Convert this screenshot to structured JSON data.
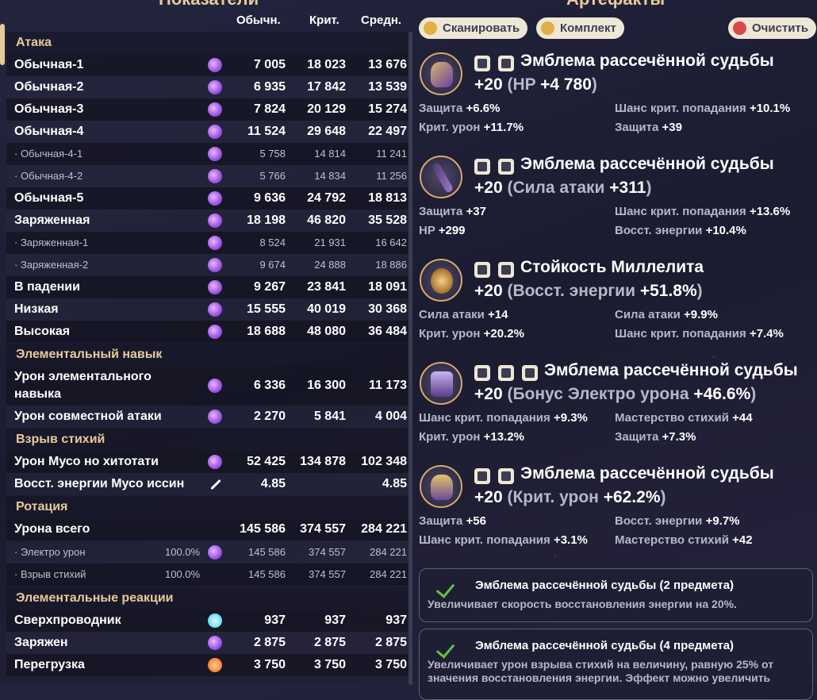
{
  "stats_title": "Показатели",
  "columns": {
    "normal": "Обычн.",
    "crit": "Крит.",
    "avg": "Средн."
  },
  "sections": [
    {
      "title": "Атака"
    },
    {
      "title": "Элементальный навык"
    },
    {
      "title": "Взрыв стихий"
    },
    {
      "title": "Ротация"
    },
    {
      "title": "Элементальные реакции"
    }
  ],
  "rows": [
    {
      "name": "Обычная-1",
      "icon": "electro-icon",
      "normal": "7 005",
      "crit": "18 023",
      "avg": "13 676"
    },
    {
      "name": "Обычная-2",
      "icon": "electro-icon",
      "normal": "6 935",
      "crit": "17 842",
      "avg": "13 539"
    },
    {
      "name": "Обычная-3",
      "icon": "electro-icon",
      "normal": "7 824",
      "crit": "20 129",
      "avg": "15 274"
    },
    {
      "name": "Обычная-4",
      "icon": "electro-icon",
      "normal": "11 524",
      "crit": "29 648",
      "avg": "22 497"
    },
    {
      "name": "· Обычная-4-1",
      "icon": "electro-icon",
      "normal": "5 758",
      "crit": "14 814",
      "avg": "11 241"
    },
    {
      "name": "· Обычная-4-2",
      "icon": "electro-icon",
      "normal": "5 766",
      "crit": "14 834",
      "avg": "11 256"
    },
    {
      "name": "Обычная-5",
      "icon": "electro-icon",
      "normal": "9 636",
      "crit": "24 792",
      "avg": "18 813"
    },
    {
      "name": "Заряженная",
      "icon": "electro-icon",
      "normal": "18 198",
      "crit": "46 820",
      "avg": "35 528"
    },
    {
      "name": "· Заряженная-1",
      "icon": "electro-icon",
      "normal": "8 524",
      "crit": "21 931",
      "avg": "16 642"
    },
    {
      "name": "· Заряженная-2",
      "icon": "electro-icon",
      "normal": "9 674",
      "crit": "24 888",
      "avg": "18 886"
    },
    {
      "name": "В падении",
      "icon": "electro-icon",
      "normal": "9 267",
      "crit": "23 841",
      "avg": "18 091"
    },
    {
      "name": "Низкая",
      "icon": "electro-icon",
      "normal": "15 555",
      "crit": "40 019",
      "avg": "30 368"
    },
    {
      "name": "Высокая",
      "icon": "electro-icon",
      "normal": "18 688",
      "crit": "48 080",
      "avg": "36 484"
    },
    {
      "name": "Урон элементального навыка",
      "icon": "electro-icon",
      "normal": "6 336",
      "crit": "16 300",
      "avg": "11 173"
    },
    {
      "name": "Урон совместной атаки",
      "icon": "electro-icon",
      "normal": "2 270",
      "crit": "5 841",
      "avg": "4 004"
    },
    {
      "name": "Урон Мусо но хитотати",
      "icon": "electro-icon",
      "normal": "52 425",
      "crit": "134 878",
      "avg": "102 348"
    },
    {
      "name": "Восст. энергии Мусо иссин",
      "icon": "sword-icon",
      "normal": "4.85",
      "crit": "",
      "avg": "4.85"
    },
    {
      "name": "Урона всего",
      "icon": "",
      "normal": "145 586",
      "crit": "374 557",
      "avg": "284 221"
    },
    {
      "name": "· Электро урон",
      "pct": "100.0%",
      "icon": "electro-icon",
      "normal": "145 586",
      "crit": "374 557",
      "avg": "284 221"
    },
    {
      "name": "· Взрыв стихий",
      "pct": "100.0%",
      "icon": "",
      "normal": "145 586",
      "crit": "374 557",
      "avg": "284 221"
    },
    {
      "name": "Сверхпроводник",
      "icon": "cryo-icon",
      "normal": "937",
      "crit": "937",
      "avg": "937"
    },
    {
      "name": "Заряжен",
      "icon": "electro-icon",
      "normal": "2 875",
      "crit": "2 875",
      "avg": "2 875"
    },
    {
      "name": "Перегрузка",
      "icon": "pyro-icon",
      "normal": "3 750",
      "crit": "3 750",
      "avg": "3 750"
    }
  ],
  "artifacts_title": "Артефакты",
  "toolbar": {
    "scan": "Сканировать",
    "set": "Комплект",
    "clear": "Очистить"
  },
  "artifacts": [
    {
      "name": "Эмблема рассечённой судьбы",
      "level": "+20",
      "main_stat": "HP",
      "main_value": "+4 780",
      "subs": [
        {
          "label": "Защита",
          "value": "+6.6%"
        },
        {
          "label": "Шанс крит. попадания",
          "value": "+10.1%"
        },
        {
          "label": "Крит. урон",
          "value": "+11.7%"
        },
        {
          "label": "Защита",
          "value": "+39"
        }
      ]
    },
    {
      "name": "Эмблема рассечённой судьбы",
      "level": "+20",
      "main_stat": "Сила атаки",
      "main_value": "+311",
      "subs": [
        {
          "label": "Защита",
          "value": "+37"
        },
        {
          "label": "Шанс крит. попадания",
          "value": "+13.6%"
        },
        {
          "label": "HP",
          "value": "+299"
        },
        {
          "label": "Восст. энергии",
          "value": "+10.4%"
        }
      ]
    },
    {
      "name": "Стойкость Миллелита",
      "level": "+20",
      "main_stat": "Восст. энергии",
      "main_value": "+51.8%",
      "subs": [
        {
          "label": "Сила атаки",
          "value": "+14"
        },
        {
          "label": "Сила атаки",
          "value": "+9.9%"
        },
        {
          "label": "Крит. урон",
          "value": "+20.2%"
        },
        {
          "label": "Шанс крит. попадания",
          "value": "+7.4%"
        }
      ]
    },
    {
      "name": "Эмблема рассечённой судьбы",
      "level": "+20",
      "main_stat": "Бонус Электро урона",
      "main_value": "+46.6%",
      "subs": [
        {
          "label": "Шанс крит. попадания",
          "value": "+9.3%"
        },
        {
          "label": "Мастерство стихий",
          "value": "+44"
        },
        {
          "label": "Крит. урон",
          "value": "+13.2%"
        },
        {
          "label": "Защита",
          "value": "+7.3%"
        }
      ]
    },
    {
      "name": "Эмблема рассечённой судьбы",
      "level": "+20",
      "main_stat": "Крит. урон",
      "main_value": "+62.2%",
      "subs": [
        {
          "label": "Защита",
          "value": "+56"
        },
        {
          "label": "Восст. энергии",
          "value": "+9.7%"
        },
        {
          "label": "Шанс крит. попадания",
          "value": "+3.1%"
        },
        {
          "label": "Мастерство стихий",
          "value": "+42"
        }
      ]
    }
  ],
  "set_bonuses": [
    {
      "name": "Эмблема рассечённой судьбы (2 предмета)",
      "desc": "Увеличивает скорость восстановления энергии на 20%."
    },
    {
      "name": "Эмблема рассечённой судьбы (4 предмета)",
      "desc": "Увеличивает урон взрыва стихий на величину, равную 25% от значения восстановления энергии. Эффект можно увеличить"
    }
  ]
}
